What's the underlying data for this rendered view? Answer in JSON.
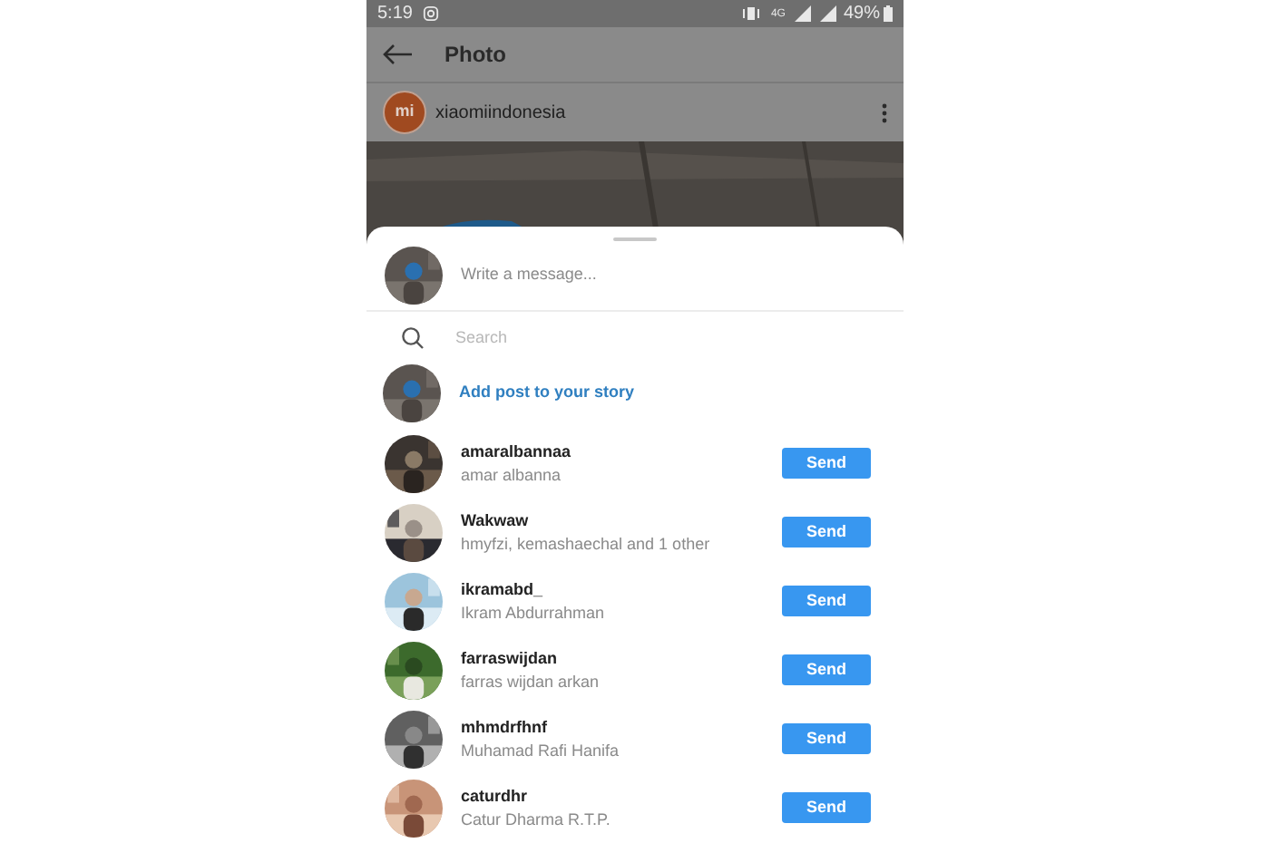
{
  "status_bar": {
    "time": "5:19",
    "battery": "49%",
    "network": "4G"
  },
  "app_bar": {
    "title": "Photo"
  },
  "post": {
    "username": "xiaomiindonesia",
    "avatar_text": "mi"
  },
  "share_sheet": {
    "message": {
      "placeholder": "Write a message..."
    },
    "search": {
      "placeholder": "Search"
    },
    "story": {
      "label": "Add post to your story"
    },
    "recipients": [
      {
        "username": "amaralbannaa",
        "name": "amar albanna",
        "action": "Send"
      },
      {
        "username": "Wakwaw",
        "name": "hmyfzi, kemashaechal and 1 other",
        "action": "Send"
      },
      {
        "username": "ikramabd_",
        "name": "Ikram Abdurrahman",
        "action": "Send"
      },
      {
        "username": "farraswijdan",
        "name": "farras wijdan arkan",
        "action": "Send"
      },
      {
        "username": "mhmdrfhnf",
        "name": "Muhamad Rafi Hanifa",
        "action": "Send"
      },
      {
        "username": "caturdhr",
        "name": "Catur Dharma R.T.P.",
        "action": "Send"
      }
    ]
  }
}
